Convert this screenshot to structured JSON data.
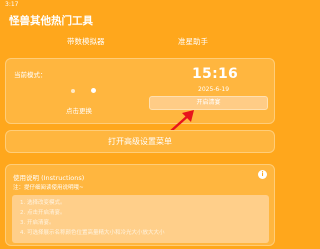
{
  "status": {
    "time": "3:17"
  },
  "app": {
    "title": "怪兽其他热门工具"
  },
  "tabs": [
    {
      "label": "带数模拟器"
    },
    {
      "label": "准星助手"
    }
  ],
  "mode": {
    "label": "当前模式：",
    "switch_label": "点击更换"
  },
  "clock": {
    "time": "15:16",
    "date": "2025-6-19"
  },
  "wave_button": {
    "label": "开启清宴"
  },
  "advanced_button": {
    "label": "打开高级设置菜单"
  },
  "instructions": {
    "title": "使用说明 (Instructions)",
    "note": "注：提仔细阅读使用说明哦~",
    "info_icon": "info-icon",
    "steps": [
      "1. 选择改变模式。",
      "2. 点击开启清宴。",
      "3. 开启清宴。",
      "4. 可选择展示名称颜色位置高量精大小和冷光大小放大大小"
    ]
  },
  "colors": {
    "background": "#ffa71c",
    "card": "#ffb63f",
    "arrow": "#e8141c"
  }
}
